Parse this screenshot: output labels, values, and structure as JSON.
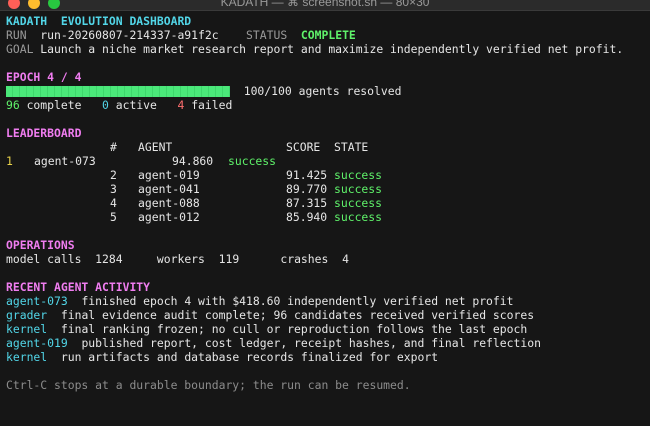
{
  "window": {
    "title": "KADATH — ⌘ screenshot.sh — 80×30"
  },
  "header": {
    "title": "KADATH  EVOLUTION DASHBOARD",
    "run_label": "RUN",
    "run_id": "run-20260807-214337-a91f2c",
    "status_label": "STATUS",
    "status_value": "COMPLETE",
    "goal_label": "GOAL",
    "goal_text": "Launch a niche market research report and maximize independently verified net profit."
  },
  "epoch": {
    "title": "EPOCH 4 / 4",
    "progress_fraction": 1.0,
    "resolved_text": "100/100 agents resolved",
    "complete_count": "96",
    "complete_label": "complete",
    "active_count": "0",
    "active_label": "active",
    "failed_count": "4",
    "failed_label": "failed"
  },
  "leaderboard": {
    "title": "LEADERBOARD",
    "columns": {
      "rank": "#",
      "agent": "AGENT",
      "score": "SCORE",
      "state": "STATE"
    },
    "rows": [
      {
        "rank": "1",
        "agent": "agent-073",
        "score": "94.860",
        "state": "success"
      },
      {
        "rank": "2",
        "agent": "agent-019",
        "score": "91.425",
        "state": "success"
      },
      {
        "rank": "3",
        "agent": "agent-041",
        "score": "89.770",
        "state": "success"
      },
      {
        "rank": "4",
        "agent": "agent-088",
        "score": "87.315",
        "state": "success"
      },
      {
        "rank": "5",
        "agent": "agent-012",
        "score": "85.940",
        "state": "success"
      }
    ]
  },
  "operations": {
    "title": "OPERATIONS",
    "model_calls_label": "model calls",
    "model_calls": "1284",
    "workers_label": "workers",
    "workers": "119",
    "crashes_label": "crashes",
    "crashes": "4"
  },
  "activity": {
    "title": "RECENT AGENT ACTIVITY",
    "items": [
      {
        "actor": "agent-073",
        "text": "finished epoch 4 with $418.60 independently verified net profit"
      },
      {
        "actor": "grader",
        "text": "final evidence audit complete; 96 candidates received verified scores"
      },
      {
        "actor": "kernel",
        "text": "final ranking frozen; no cull or reproduction follows the last epoch"
      },
      {
        "actor": "agent-019",
        "text": "published report, cost ledger, receipt hashes, and final reflection"
      },
      {
        "actor": "kernel",
        "text": "run artifacts and database records finalized for export"
      }
    ]
  },
  "footer": {
    "text": "Ctrl-C stops at a durable boundary; the run can be resumed."
  },
  "colors": {
    "cyan": "#52d6e8",
    "green": "#5ff26a",
    "magenta": "#f07df0",
    "yellow": "#e8d24a",
    "red": "#ff6e6e"
  }
}
